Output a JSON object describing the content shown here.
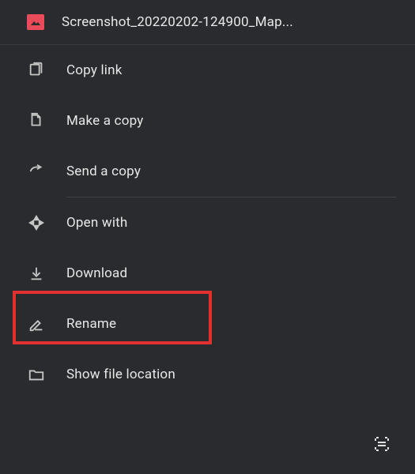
{
  "header": {
    "filename": "Screenshot_20220202-124900_Map..."
  },
  "menu": {
    "copy_link": "Copy link",
    "make_copy": "Make a copy",
    "send_copy": "Send a copy",
    "open_with": "Open with",
    "download": "Download",
    "rename": "Rename",
    "show_location": "Show file location"
  }
}
